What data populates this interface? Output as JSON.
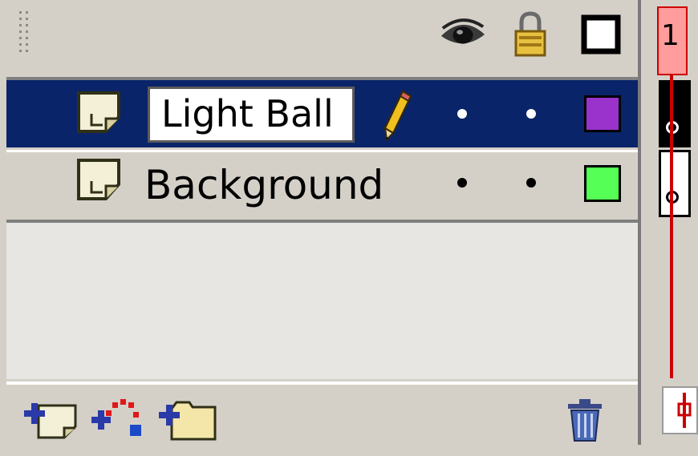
{
  "header": {
    "columns": [
      "eye-icon",
      "lock-icon",
      "outline-icon"
    ]
  },
  "layers": [
    {
      "name": "Light Ball",
      "selected": true,
      "editing": true,
      "outline_color": "#9933cc"
    },
    {
      "name": "Background",
      "selected": false,
      "editing": false,
      "outline_color": "#55ff55"
    }
  ],
  "footer": {
    "buttons": [
      "insert-layer-icon",
      "add-motion-guide-icon",
      "insert-layer-folder-icon",
      "delete-layer-icon"
    ]
  },
  "timeline": {
    "frame_number": "1",
    "keyframe_symbol": "o"
  },
  "colors": {
    "selection": "#0a246a",
    "panel": "#d4d0c8",
    "playhead": "#cc0000",
    "playhead_fill": "#ff9c9c"
  }
}
